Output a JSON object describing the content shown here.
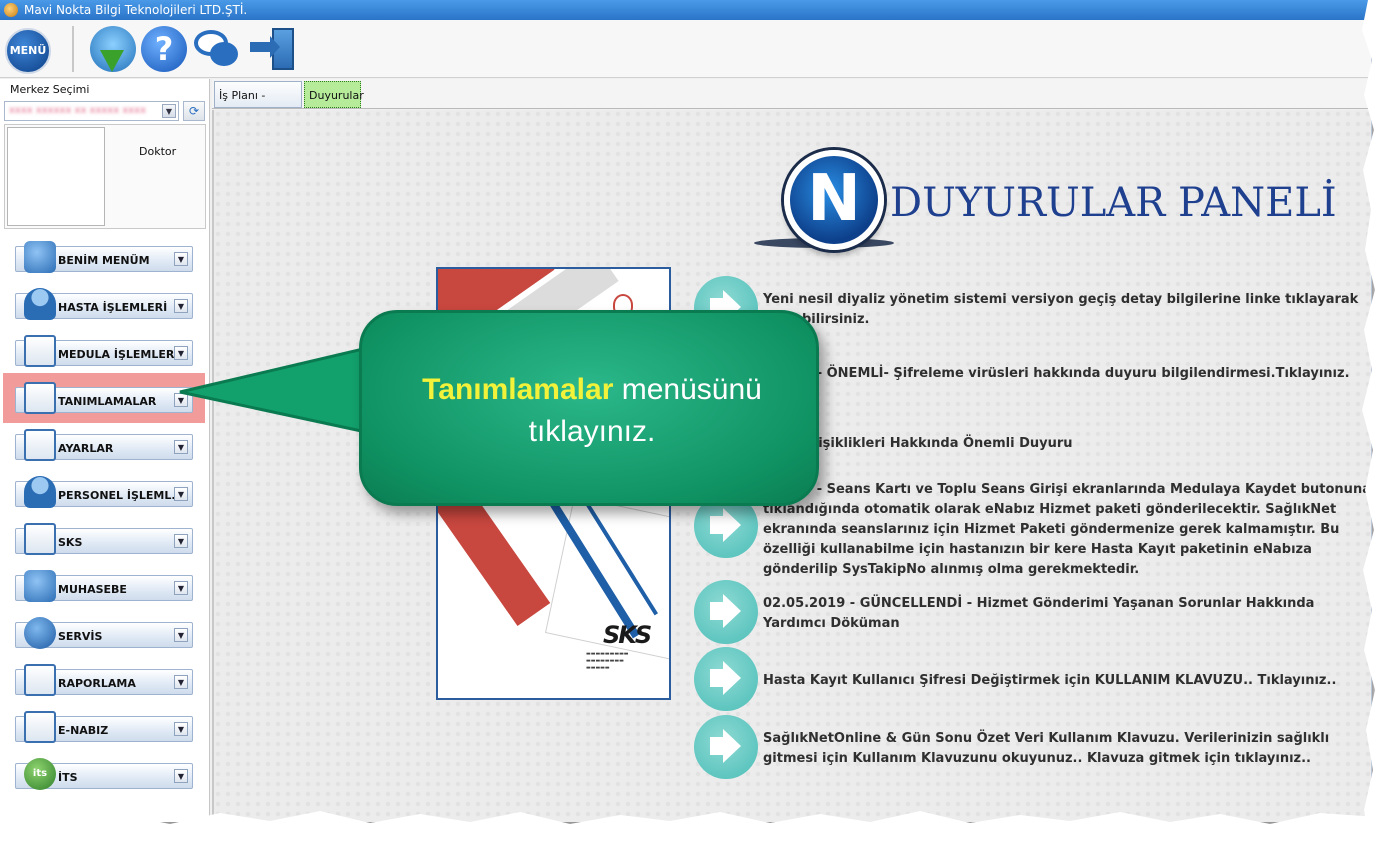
{
  "window": {
    "title": "Mavi Nokta Bilgi Teknolojileri LTD.ŞTİ."
  },
  "toolbar": {
    "menu_label": "MENÜ",
    "buttons": [
      {
        "icon": "update-download-icon"
      },
      {
        "icon": "help-icon",
        "glyph": "?"
      },
      {
        "icon": "chat-icon"
      },
      {
        "icon": "exit-door-icon"
      }
    ]
  },
  "sidebar": {
    "center_label": "Merkez Seçimi",
    "center_value": "xxxx xxxxxx xx xxxxx xxxx",
    "role": "Doktor",
    "items": [
      {
        "label": "BENİM MENÜM",
        "icon": "refresh-arrows-icon"
      },
      {
        "label": "HASTA İŞLEMLERİ",
        "icon": "patient-icon"
      },
      {
        "label": "MEDULA İŞLEMLERİ",
        "icon": "windows-icon"
      },
      {
        "label": "TANIMLAMALAR",
        "icon": "clipboard-icon"
      },
      {
        "label": "AYARLAR",
        "icon": "settings-clock-icon"
      },
      {
        "label": "PERSONEL İŞLEML...",
        "icon": "staff-icon"
      },
      {
        "label": "SKS",
        "icon": "medical-clipboard-icon"
      },
      {
        "label": "MUHASEBE",
        "icon": "medical-bag-icon"
      },
      {
        "label": "SERVİS",
        "icon": "gear-icon"
      },
      {
        "label": "RAPORLAMA",
        "icon": "sql-report-icon"
      },
      {
        "label": "E-NABIZ",
        "icon": "pulse-monitor-icon"
      },
      {
        "label": "İTS",
        "icon": "its-logo-icon",
        "glyph": "its"
      }
    ]
  },
  "tabs": [
    {
      "label": "İş Planı - Ajanda",
      "active": false
    },
    {
      "label": "Duyurular",
      "active": true
    }
  ],
  "panel": {
    "logo_letter": "N",
    "title": "DUYURULAR PANELİ",
    "cover": {
      "brand": "SKS"
    },
    "announcements": [
      {
        "text": "Yeni nesil diyaliz yönetim sistemi versiyon geçiş detay bilgilerine linke tıklayarak ulaşabilirsiniz."
      },
      {
        "text": "…2019 - ÖNEMLİ- Şifreleme virüsleri hakkında duyuru bilgilendirmesi.Tıklayınız."
      },
      {
        "text": "…a Değişiklikleri Hakkında Önemli Duyuru"
      },
      {
        "text": "…2019 - Seans Kartı ve Toplu Seans Girişi ekranlarında Medulaya Kaydet butonuna tıklandığında otomatik olarak eNabız Hizmet paketi gönderilecektir. SağlıkNet ekranında seanslarınız için Hizmet Paketi göndermenize gerek kalmamıştır. Bu özelliği kullanabilme için hastanızın bir kere Hasta Kayıt paketinin eNabıza gönderilip SysTakipNo alınmış olma gerekmektedir."
      },
      {
        "text": "02.05.2019 - GÜNCELLENDİ - Hizmet Gönderimi Yaşanan Sorunlar Hakkında Yardımcı Döküman"
      },
      {
        "text": "Hasta Kayıt Kullanıcı Şifresi Değiştirmek için KULLANIM KLAVUZU.. Tıklayınız.."
      },
      {
        "text": "SağlıkNetOnline & Gün Sonu Özet Veri Kullanım Klavuzu. Verilerinizin sağlıklı gitmesi için Kullanım Klavuzunu okuyunuz.. Klavuza gitmek için tıklayınız.."
      }
    ]
  },
  "callout": {
    "highlight": "Tanımlamalar",
    "rest": " menüsünü tıklayınız.",
    "color": "#12a06c"
  }
}
